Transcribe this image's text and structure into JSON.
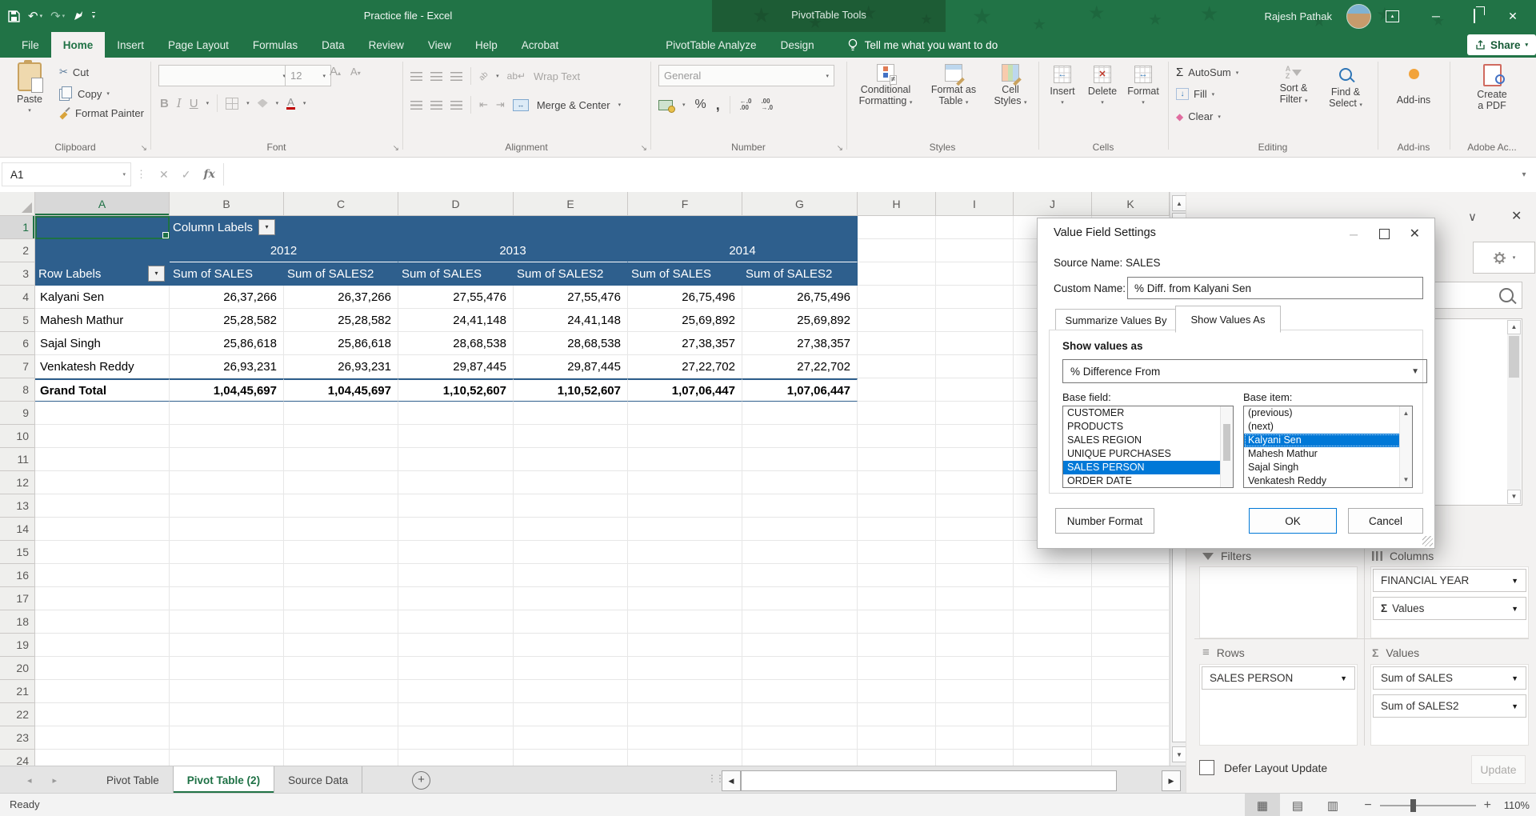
{
  "colors": {
    "excel_green": "#217346",
    "contextual_green": "#1D5C35",
    "pivot_blue": "#2E5F8D",
    "selection_blue": "#0078D7"
  },
  "titlebar": {
    "title": "Practice file  -  Excel",
    "contextual": "PivotTable Tools",
    "user": "Rajesh Pathak"
  },
  "tabs": {
    "items": [
      "File",
      "Home",
      "Insert",
      "Page Layout",
      "Formulas",
      "Data",
      "Review",
      "View",
      "Help",
      "Acrobat",
      "PivotTable Analyze",
      "Design"
    ],
    "active": "Home",
    "tell_me": "Tell me what you want to do",
    "share": "Share"
  },
  "ribbon": {
    "clipboard": {
      "label": "Clipboard",
      "paste": "Paste",
      "cut": "Cut",
      "copy": "Copy",
      "format_painter": "Format Painter"
    },
    "font": {
      "label": "Font",
      "size": "12",
      "bold": "B",
      "italic": "I",
      "underline": "U"
    },
    "alignment": {
      "label": "Alignment",
      "wrap_text": "Wrap Text",
      "merge_center": "Merge & Center"
    },
    "number": {
      "label": "Number",
      "format": "General"
    },
    "styles": {
      "label": "Styles",
      "conditional1": "Conditional",
      "conditional2": "Formatting",
      "format_table1": "Format as",
      "format_table2": "Table",
      "cell_styles1": "Cell",
      "cell_styles2": "Styles"
    },
    "cells": {
      "label": "Cells",
      "insert": "Insert",
      "delete": "Delete",
      "format": "Format"
    },
    "editing": {
      "label": "Editing",
      "autosum": "AutoSum",
      "fill": "Fill",
      "clear": "Clear",
      "sort1": "Sort &",
      "sort2": "Filter",
      "find1": "Find &",
      "find2": "Select"
    },
    "addins": {
      "label": "Add-ins",
      "button": "Add-ins"
    },
    "adobe": {
      "label": "Adobe Ac...",
      "button1": "Create",
      "button2": "a PDF"
    }
  },
  "formula_bar": {
    "name_box": "A1",
    "fx": "fx",
    "formula": ""
  },
  "grid": {
    "col_headers": [
      "A",
      "B",
      "C",
      "D",
      "E",
      "F",
      "G",
      "H",
      "I",
      "J",
      "K"
    ],
    "row_count": 24,
    "pivot": {
      "column_labels": "Column Labels",
      "row_labels": "Row Labels",
      "years": [
        "2012",
        "2013",
        "2014"
      ],
      "value_headers": [
        "Sum of SALES",
        "Sum of SALES2",
        "Sum of SALES",
        "Sum of SALES2",
        "Sum of SALES",
        "Sum of SALES2"
      ],
      "data_rows": [
        {
          "name": "Kalyani Sen",
          "values": [
            "26,37,266",
            "26,37,266",
            "27,55,476",
            "27,55,476",
            "26,75,496",
            "26,75,496"
          ]
        },
        {
          "name": "Mahesh Mathur",
          "values": [
            "25,28,582",
            "25,28,582",
            "24,41,148",
            "24,41,148",
            "25,69,892",
            "25,69,892"
          ]
        },
        {
          "name": "Sajal Singh",
          "values": [
            "25,86,618",
            "25,86,618",
            "28,68,538",
            "28,68,538",
            "27,38,357",
            "27,38,357"
          ]
        },
        {
          "name": "Venkatesh Reddy",
          "values": [
            "26,93,231",
            "26,93,231",
            "29,87,445",
            "29,87,445",
            "27,22,702",
            "27,22,702"
          ]
        }
      ],
      "grand_total": {
        "name": "Grand Total",
        "values": [
          "1,04,45,697",
          "1,04,45,697",
          "1,10,52,607",
          "1,10,52,607",
          "1,07,06,447",
          "1,07,06,447"
        ]
      }
    }
  },
  "dialog": {
    "title": "Value Field Settings",
    "source_name_label": "Source Name:",
    "source_name": "SALES",
    "custom_name_label": "Custom Name:",
    "custom_name": "% Diff. from Kalyani Sen",
    "tab_summarize": "Summarize Values By",
    "tab_show": "Show Values As",
    "show_values_heading": "Show values as",
    "show_values_value": "% Difference From",
    "base_field_label": "Base field:",
    "base_item_label": "Base item:",
    "base_fields": [
      "CUSTOMER",
      "PRODUCTS",
      "SALES REGION",
      "UNIQUE PURCHASES",
      "SALES PERSON",
      "ORDER DATE"
    ],
    "base_field_selected": "SALES PERSON",
    "base_items": [
      "(previous)",
      "(next)",
      "Kalyani Sen",
      "Mahesh Mathur",
      "Sajal Singh",
      "Venkatesh Reddy"
    ],
    "base_item_selected": "Kalyani Sen",
    "number_format": "Number Format",
    "ok": "OK",
    "cancel": "Cancel"
  },
  "pane": {
    "filters_label": "Filters",
    "columns_label": "Columns",
    "rows_label": "Rows",
    "values_label": "Values",
    "columns_items": [
      {
        "label": "FINANCIAL YEAR",
        "sigma": false
      },
      {
        "label": "Values",
        "sigma": true
      }
    ],
    "rows_items": [
      {
        "label": "SALES PERSON",
        "sigma": false
      }
    ],
    "values_items": [
      {
        "label": "Sum of SALES",
        "sigma": false
      },
      {
        "label": "Sum of SALES2",
        "sigma": false
      }
    ],
    "defer": "Defer Layout Update",
    "update": "Update"
  },
  "sheet_bar": {
    "tabs": [
      "Pivot Table",
      "Pivot Table (2)",
      "Source Data"
    ],
    "active": "Pivot Table (2)"
  },
  "status_bar": {
    "ready": "Ready",
    "zoom_level": "110%"
  }
}
